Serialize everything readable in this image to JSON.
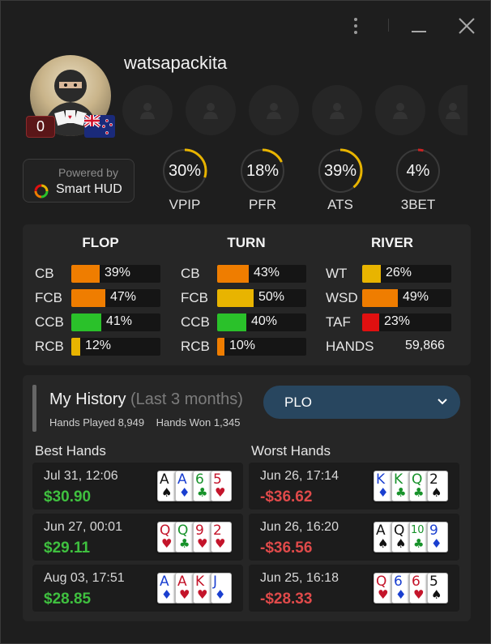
{
  "player": {
    "username": "watsapackita",
    "badge_count": "0",
    "flag_icon": "new-zealand-flag-icon",
    "empty_seats": 6
  },
  "powered_by": {
    "line1": "Powered by",
    "line2": "Smart HUD"
  },
  "gauges": [
    {
      "value": "30%",
      "label": "VPIP",
      "level": 0.3
    },
    {
      "value": "18%",
      "label": "PFR",
      "level": 0.18
    },
    {
      "value": "39%",
      "label": "ATS",
      "level": 0.39
    },
    {
      "value": "4%",
      "label": "3BET",
      "level": 0.04
    }
  ],
  "gauge_colors": {
    "ring": "#3a3a3a",
    "arc": "#e8b400",
    "arc_low": "#cc2222"
  },
  "streets": {
    "flop": {
      "title": "FLOP",
      "rows": [
        {
          "key": "CB",
          "pct": "39%",
          "level": 0.39,
          "color": "#ef7d00"
        },
        {
          "key": "FCB",
          "pct": "47%",
          "level": 0.47,
          "color": "#ef7d00"
        },
        {
          "key": "CCB",
          "pct": "41%",
          "level": 0.41,
          "color": "#2ac12a"
        },
        {
          "key": "RCB",
          "pct": "12%",
          "level": 0.12,
          "color": "#e8b400"
        }
      ]
    },
    "turn": {
      "title": "TURN",
      "rows": [
        {
          "key": "CB",
          "pct": "43%",
          "level": 0.43,
          "color": "#ef7d00"
        },
        {
          "key": "FCB",
          "pct": "50%",
          "level": 0.5,
          "color": "#e8b400"
        },
        {
          "key": "CCB",
          "pct": "40%",
          "level": 0.4,
          "color": "#2ac12a"
        },
        {
          "key": "RCB",
          "pct": "10%",
          "level": 0.1,
          "color": "#ef7d00"
        }
      ]
    },
    "river": {
      "title": "RIVER",
      "rows": [
        {
          "key": "WT",
          "pct": "26%",
          "level": 0.26,
          "color": "#e8b400"
        },
        {
          "key": "WSD",
          "pct": "49%",
          "level": 0.49,
          "color": "#ef7d00"
        },
        {
          "key": "TAF",
          "pct": "23%",
          "level": 0.23,
          "color": "#e01010"
        }
      ],
      "hands_label": "HANDS",
      "hands_value": "59,866"
    }
  },
  "history": {
    "title": "My History",
    "subtitle": "(Last 3 months)",
    "hands_played_label": "Hands Played",
    "hands_played": "8,949",
    "hands_won_label": "Hands Won",
    "hands_won": "1,345",
    "game_select": "PLO",
    "best_label": "Best Hands",
    "worst_label": "Worst Hands",
    "best": [
      {
        "date": "Jul 31, 12:06",
        "amount": "$30.90",
        "cards": [
          [
            "A",
            "♠"
          ],
          [
            "A",
            "♦"
          ],
          [
            "6",
            "♣"
          ],
          [
            "5",
            "♥"
          ]
        ]
      },
      {
        "date": "Jun 27, 00:01",
        "amount": "$29.11",
        "cards": [
          [
            "Q",
            "♥"
          ],
          [
            "Q",
            "♣"
          ],
          [
            "9",
            "♥"
          ],
          [
            "2",
            "♥"
          ]
        ]
      },
      {
        "date": "Aug 03, 17:51",
        "amount": "$28.85",
        "cards": [
          [
            "A",
            "♦"
          ],
          [
            "A",
            "♥"
          ],
          [
            "K",
            "♥"
          ],
          [
            "J",
            "♦"
          ]
        ]
      }
    ],
    "worst": [
      {
        "date": "Jun 26, 17:14",
        "amount": "-$36.62",
        "cards": [
          [
            "K",
            "♦"
          ],
          [
            "K",
            "♣"
          ],
          [
            "Q",
            "♣"
          ],
          [
            "2",
            "♠"
          ]
        ]
      },
      {
        "date": "Jun 26, 16:20",
        "amount": "-$36.56",
        "cards": [
          [
            "A",
            "♠"
          ],
          [
            "Q",
            "♠"
          ],
          [
            "10",
            "♣"
          ],
          [
            "9",
            "♦"
          ]
        ]
      },
      {
        "date": "Jun 25, 16:18",
        "amount": "-$28.33",
        "cards": [
          [
            "Q",
            "♥"
          ],
          [
            "6",
            "♦"
          ],
          [
            "6",
            "♥"
          ],
          [
            "5",
            "♠"
          ]
        ]
      }
    ],
    "win_color": "#3fc03f",
    "loss_color": "#e04a4a"
  },
  "suit_colors": {
    "♠": "#111111",
    "♥": "#c4142a",
    "♦": "#1a3fd0",
    "♣": "#17922a"
  }
}
